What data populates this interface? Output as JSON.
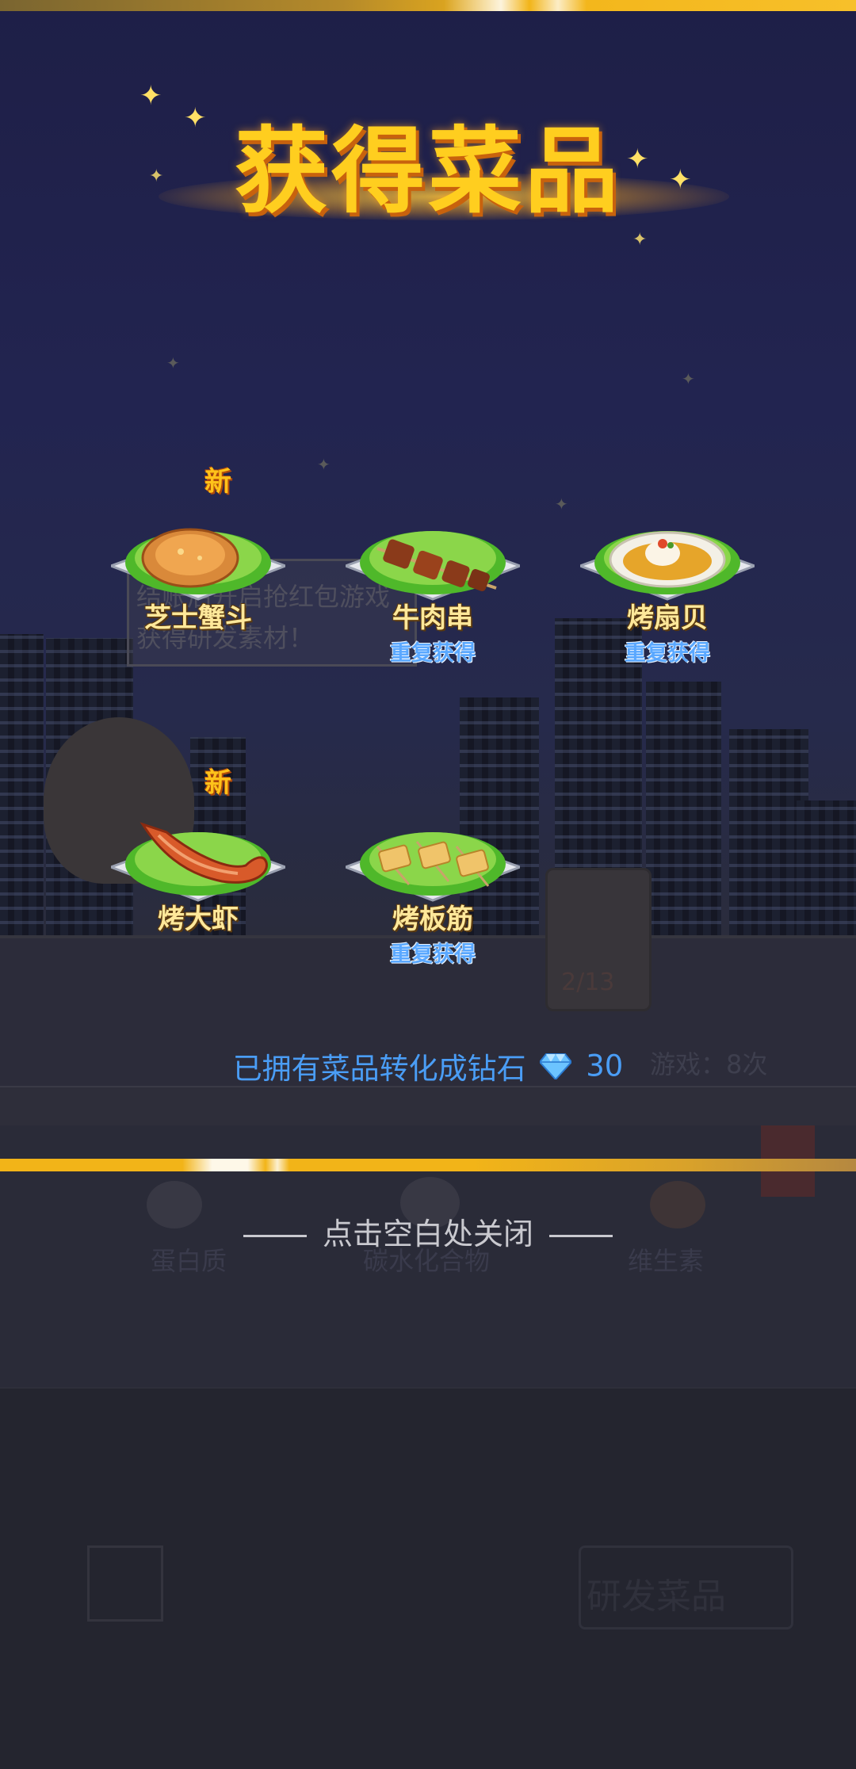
{
  "dialog": {
    "title": "获得菜品",
    "conversion_text": "已拥有菜品转化成钻石",
    "diamond_count": "30",
    "close_hint": "点击空白处关闭"
  },
  "dishes": [
    {
      "name": "芝士蟹斗",
      "badge": "新",
      "status": ""
    },
    {
      "name": "牛肉串",
      "badge": "",
      "status": "重复获得"
    },
    {
      "name": "烤扇贝",
      "badge": "",
      "status": "重复获得"
    },
    {
      "name": "烤大虾",
      "badge": "新",
      "status": ""
    },
    {
      "name": "烤板筋",
      "badge": "",
      "status": "重复获得"
    }
  ],
  "background": {
    "speech_line1": "结账后开启抢红包游戏",
    "speech_line2": "获得研发素材！",
    "card_progress": "2/13",
    "games_left": "游戏：8次",
    "nutrient_labels": [
      "蛋白质",
      "碳水化合物",
      "维生素"
    ],
    "button_label": "研发菜品"
  },
  "colors": {
    "title": "#ffce1f",
    "dish_name": "#ffe89a",
    "status_blue": "#5aa8ff",
    "conversion_blue": "#4a9df5",
    "gold_bar": "#f2b418"
  },
  "icons": [
    "sparkle-icon",
    "diamond-icon",
    "dish-plate-icon"
  ]
}
